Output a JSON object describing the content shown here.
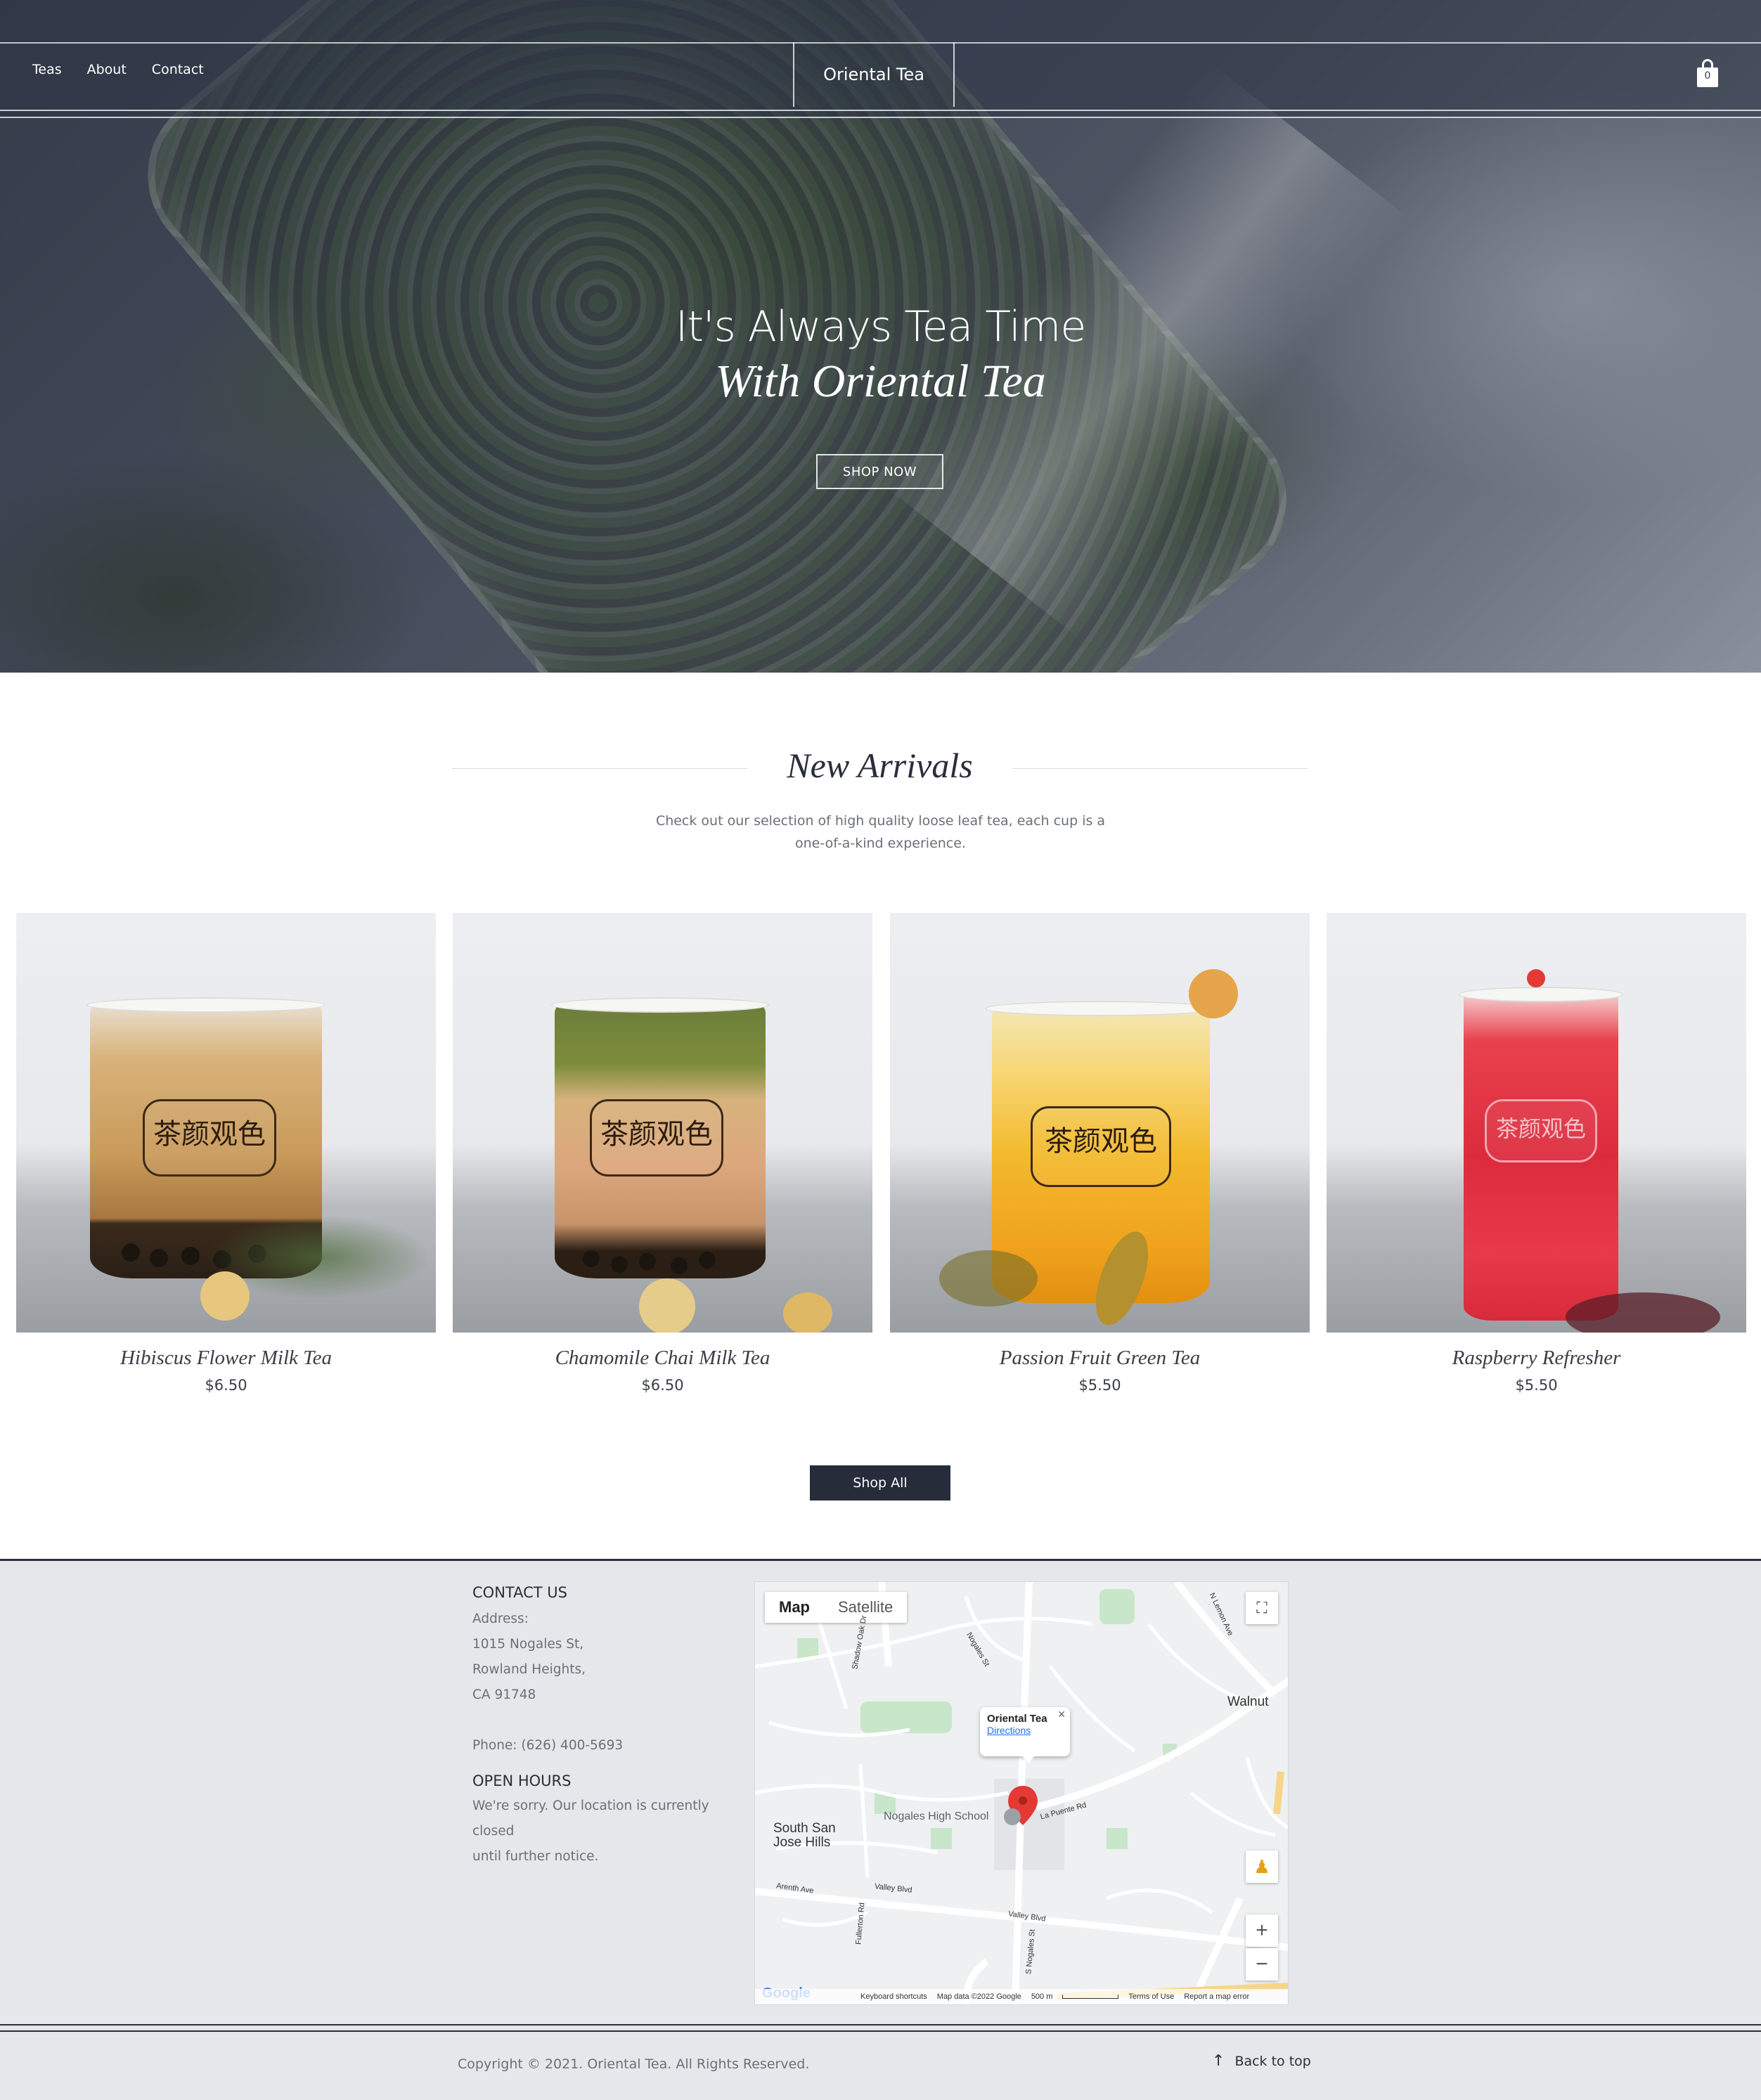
{
  "nav": {
    "links": [
      "Teas",
      "About",
      "Contact"
    ],
    "brand": "Oriental Tea",
    "cart_count": "0"
  },
  "hero": {
    "title_line1": "It's Always Tea Time",
    "title_line2": "With Oriental Tea",
    "cta": "SHOP NOW"
  },
  "new_arrivals": {
    "title": "New Arrivals",
    "subtitle_line1": "Check out our selection of high quality loose leaf tea, each cup is a",
    "subtitle_line2": "one-of-a-kind experience.",
    "products": [
      {
        "name": "Hibiscus Flower Milk Tea",
        "price": "$6.50",
        "seal_text": "茶颜观色"
      },
      {
        "name": "Chamomile Chai Milk Tea",
        "price": "$6.50",
        "seal_text": "茶颜观色"
      },
      {
        "name": "Passion Fruit Green Tea",
        "price": "$5.50",
        "seal_text": "茶颜观色"
      },
      {
        "name": "Raspberry Refresher",
        "price": "$5.50",
        "seal_text": "茶颜观色"
      }
    ],
    "shop_all": "Shop All"
  },
  "contact": {
    "heading": "CONTACT US",
    "address_label": "Address:",
    "address_line1": "1015 Nogales St,",
    "address_line2": "Rowland Heights,",
    "address_line3": "CA 91748",
    "phone": "Phone: (626) 400-5693",
    "hours_heading": "OPEN HOURS",
    "hours_line1": "We're sorry. Our location is currently closed",
    "hours_line2": "until further notice."
  },
  "map": {
    "tab_map": "Map",
    "tab_satellite": "Satellite",
    "place_name": "Oriental Tea",
    "directions": "Directions",
    "labels": {
      "walnut": "Walnut",
      "south_san_jose_1": "South San",
      "south_san_jose_2": "Jose Hills",
      "school": "Nogales High School",
      "valley_blvd": "Valley Blvd",
      "la_puente": "La Puente Rd",
      "nogales_st": "Nogales St",
      "s_nogales_st": "S Nogales St",
      "arenth": "Arenth Ave",
      "fullerton": "Fullerton Rd",
      "shadow_oak": "Shadow Oak Dr",
      "n_lemon": "N Lemon Ave"
    },
    "footer": {
      "keyboard": "Keyboard shortcuts",
      "map_data": "Map data ©2022 Google",
      "scale": "500 m",
      "terms": "Terms of Use",
      "report": "Report a map error"
    },
    "google": "Google",
    "colors": {
      "marker": "#e53935",
      "park": "#c5e8c5",
      "road": "#ffffff"
    }
  },
  "footer": {
    "copyright": "Copyright © 2021. Oriental Tea. All Rights Reserved.",
    "back_to_top": "Back to top"
  }
}
